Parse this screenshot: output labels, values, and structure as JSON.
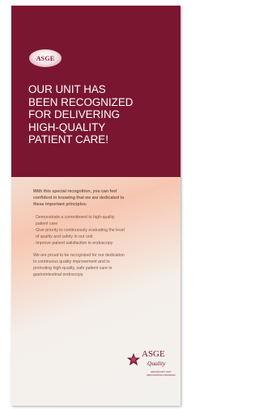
{
  "logo": {
    "text": "ASGE"
  },
  "headline": {
    "lines": [
      "OUR UNIT HAS",
      "BEEN RECOGNIZED",
      "FOR DELIVERING",
      "HIGH-QUALITY",
      "PATIENT CARE!"
    ]
  },
  "body": {
    "intro_lines": [
      "With this special recognition, you can feel",
      "confident in knowing that we are dedicated to",
      "these important principles:"
    ],
    "principles_lines": [
      "· Demonstrate a commitment to high-quality",
      "  patient care",
      "· Give priority to continuously evaluating the level",
      "  of quality and safety in our unit",
      "· Improve patient satisfaction in endoscopy"
    ],
    "closing_lines": [
      "We are proud to be recognized for our dedication",
      "to continuous quality improvement and to",
      "promoting high-quality, safe patient care in",
      "gastrointestinal endoscopy."
    ]
  },
  "badge": {
    "title": "ASGE",
    "subtitle": "Quality",
    "small_lines": [
      "ENDOSCOPY UNIT",
      "RECOGNITION PROGRAM"
    ]
  },
  "colors": {
    "maroon": "#7a1630",
    "body_text": "#7a5a4a"
  }
}
